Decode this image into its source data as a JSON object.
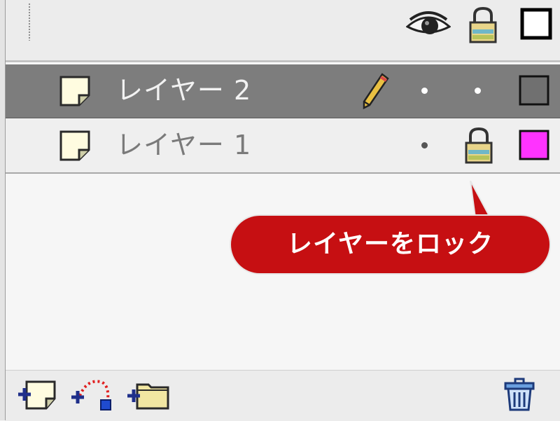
{
  "header": {
    "icons": [
      "eye-icon",
      "lock-icon",
      "outline-square-icon"
    ]
  },
  "layers": [
    {
      "name": "レイヤー 2",
      "selected": true,
      "icon": "layer-page-icon",
      "edit_icon": "pencil-icon",
      "visible_indicator": "dot",
      "lock_indicator": "dot",
      "outline_color": "#707070"
    },
    {
      "name": "レイヤー 1",
      "selected": false,
      "icon": "layer-page-icon",
      "visible_indicator": "dot",
      "lock_indicator": "lock-icon",
      "outline_color": "#ff33ff"
    }
  ],
  "callout": {
    "text": "レイヤーをロック",
    "color": "#c60f12"
  },
  "toolbar": {
    "icons": [
      "add-layer-icon",
      "add-motion-guide-icon",
      "add-layer-folder-icon",
      "trash-icon"
    ]
  },
  "colors": {
    "selected_row": "#7d7d7d",
    "panel_bg": "#f4f4f4"
  }
}
